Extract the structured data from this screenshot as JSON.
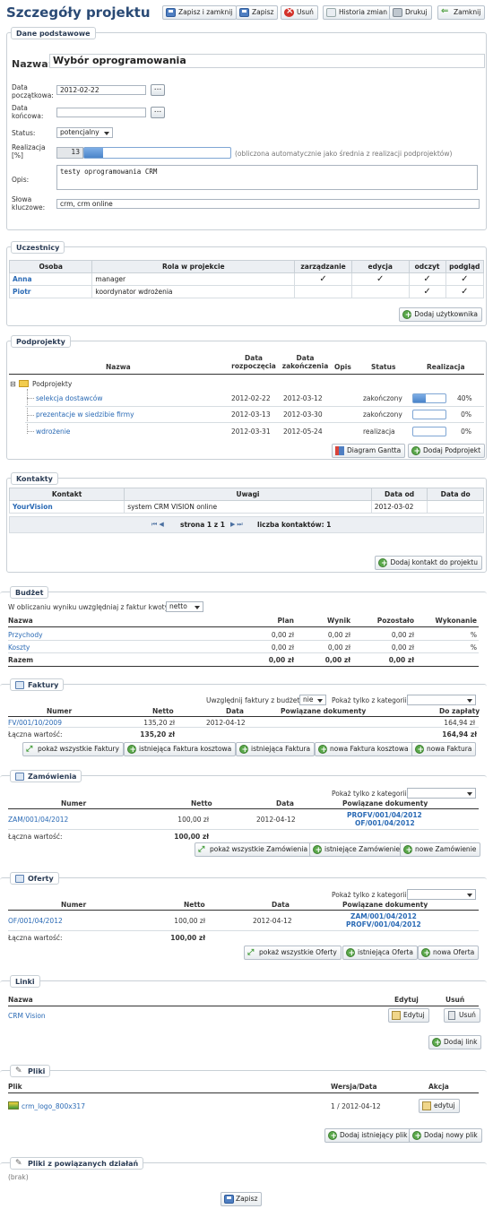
{
  "page": {
    "title": "Szczegóły projektu"
  },
  "toolbar": {
    "save_close": "Zapisz i zamknij",
    "save": "Zapisz",
    "delete": "Usuń",
    "history": "Historia zmian",
    "print": "Drukuj",
    "close": "Zamknij"
  },
  "basic": {
    "legend": "Dane podstawowe",
    "name_label": "Nazwa:",
    "name_value": "Wybór oprogramowania",
    "start_label_1": "Data",
    "start_label_2": "początkowa:",
    "start_value": "2012-02-22",
    "end_label_1": "Data",
    "end_label_2": "końcowa:",
    "end_value": "",
    "dots": "...",
    "status_label": "Status:",
    "status_value": "potencjalny",
    "real_label_1": "Realizacja",
    "real_label_2": "[%]",
    "real_value": "13",
    "real_note": "(obliczona automatycznie jako średnia z realizacji podprojektów)",
    "real_fraction": 0.13,
    "desc_label": "Opis:",
    "desc_value": "testy oprogramowania CRM",
    "kw_label_1": "Słowa",
    "kw_label_2": "kluczowe:",
    "kw_value": "crm, crm online"
  },
  "participants": {
    "legend": "Uczestnicy",
    "headers": [
      "Osoba",
      "Rola w projekcie",
      "zarządzanie",
      "edycja",
      "odczyt",
      "podgląd"
    ],
    "rows": [
      {
        "person": "Anna",
        "role": "manager",
        "checks": [
          "✓",
          "✓",
          "✓",
          "✓"
        ]
      },
      {
        "person": "Piotr",
        "role": "koordynator wdrożenia",
        "checks": [
          "",
          "",
          "✓",
          "✓"
        ]
      }
    ],
    "add_button": "Dodaj użytkownika"
  },
  "subprojects": {
    "legend": "Podprojekty",
    "headers": {
      "name": "Nazwa",
      "start_1": "Data",
      "start_2": "rozpoczęcia",
      "end_1": "Data",
      "end_2": "zakończenia",
      "desc": "Opis",
      "status": "Status",
      "real": "Realizacja"
    },
    "root": "Podprojekty",
    "root_toggle": "⊟",
    "rows": [
      {
        "name": "selekcja dostawców",
        "start": "2012-02-22",
        "end": "2012-03-12",
        "status": "zakończony",
        "pct": "40%",
        "fraction": 0.4
      },
      {
        "name": "prezentacje w siedzibie firmy",
        "start": "2012-03-13",
        "end": "2012-03-30",
        "status": "zakończony",
        "pct": "0%",
        "fraction": 0
      },
      {
        "name": "wdrożenie",
        "start": "2012-03-31",
        "end": "2012-05-24",
        "status": "realizacja",
        "pct": "0%",
        "fraction": 0
      }
    ],
    "gantt_button": "Diagram Gantta",
    "add_button": "Dodaj Podprojekt"
  },
  "contacts": {
    "legend": "Kontakty",
    "headers": [
      "Kontakt",
      "Uwagi",
      "Data od",
      "Data do"
    ],
    "rows": [
      {
        "contact": "YourVision",
        "notes": "system CRM VISION online",
        "from": "2012-03-02",
        "to": ""
      }
    ],
    "pager": {
      "first": "⏮",
      "prev": "◀",
      "text": "strona 1 z 1",
      "next": "▶",
      "last": "⏭",
      "count": "liczba kontaktów: 1"
    },
    "add_button": "Dodaj kontakt do projektu"
  },
  "budget": {
    "legend": "Budżet",
    "filter_label": "W obliczaniu wyniku uwzględniaj z faktur kwoty:",
    "filter_value": "netto",
    "headers": [
      "Nazwa",
      "Plan",
      "Wynik",
      "Pozostało",
      "Wykonanie"
    ],
    "rows": [
      {
        "name": "Przychody",
        "plan": "0,00 zł",
        "result": "0,00 zł",
        "left": "0,00 zł",
        "exec": "%"
      },
      {
        "name": "Koszty",
        "plan": "0,00 zł",
        "result": "0,00 zł",
        "left": "0,00 zł",
        "exec": "%"
      }
    ],
    "total": {
      "name": "Razem",
      "plan": "0,00 zł",
      "result": "0,00 zł",
      "left": "0,00 zł"
    }
  },
  "invoices": {
    "legend": "Faktury",
    "budget_label": "Uwzględnij faktury z budżetu",
    "budget_value": "nie",
    "cat_label": "Pokaż tylko z kategorii:",
    "cat_value": "",
    "headers": [
      "Numer",
      "Netto",
      "Data",
      "Powiązane dokumenty",
      "Do zapłaty"
    ],
    "rows": [
      {
        "number": "FV/001/10/2009",
        "net": "135,20 zł",
        "date": "2012-04-12",
        "docs": "",
        "due": "164,94 zł"
      }
    ],
    "total_label": "Łączna wartość:",
    "total_net": "135,20 zł",
    "total_due": "164,94 zł",
    "buttons": [
      "pokaż wszystkie Faktury",
      "istniejąca Faktura kosztowa",
      "istniejąca Faktura",
      "nowa Faktura kosztowa",
      "nowa Faktura"
    ]
  },
  "orders": {
    "legend": "Zamówienia",
    "cat_label": "Pokaż tylko z kategorii:",
    "cat_value": "",
    "headers": [
      "Numer",
      "Netto",
      "Data",
      "Powiązane dokumenty"
    ],
    "rows": [
      {
        "number": "ZAM/001/04/2012",
        "net": "100,00 zł",
        "date": "2012-04-12",
        "doc1": "PROFV/001/04/2012",
        "doc2": "OF/001/04/2012"
      }
    ],
    "total_label": "Łączna wartość:",
    "total_net": "100,00 zł",
    "buttons": [
      "pokaż wszystkie Zamówienia",
      "istniejące Zamówienie",
      "nowe Zamówienie"
    ]
  },
  "offers": {
    "legend": "Oferty",
    "cat_label": "Pokaż tylko z kategorii:",
    "cat_value": "",
    "headers": [
      "Numer",
      "Netto",
      "Data",
      "Powiązane dokumenty"
    ],
    "rows": [
      {
        "number": "OF/001/04/2012",
        "net": "100,00 zł",
        "date": "2012-04-12",
        "doc1": "ZAM/001/04/2012",
        "doc2": "PROFV/001/04/2012"
      }
    ],
    "total_label": "Łączna wartość:",
    "total_net": "100,00 zł",
    "buttons": [
      "pokaż wszystkie Oferty",
      "istniejąca Oferta",
      "nowa Oferta"
    ]
  },
  "links": {
    "legend": "Linki",
    "headers": [
      "Nazwa",
      "Edytuj",
      "Usuń"
    ],
    "rows": [
      {
        "name": "CRM Vision",
        "edit": "Edytuj",
        "delete": "Usuń"
      }
    ],
    "add_button": "Dodaj link"
  },
  "files": {
    "legend": "Pliki",
    "headers": [
      "Plik",
      "Wersja/Data",
      "Akcja"
    ],
    "rows": [
      {
        "name": "crm_logo_800x317",
        "version": "1 / 2012-04-12",
        "action": "edytuj"
      }
    ],
    "add_existing": "Dodaj istniejący plik",
    "add_new": "Dodaj nowy plik"
  },
  "related_files": {
    "legend": "Pliki z powiązanych działań",
    "empty": "(brak)"
  },
  "footer": {
    "save": "Zapisz"
  }
}
